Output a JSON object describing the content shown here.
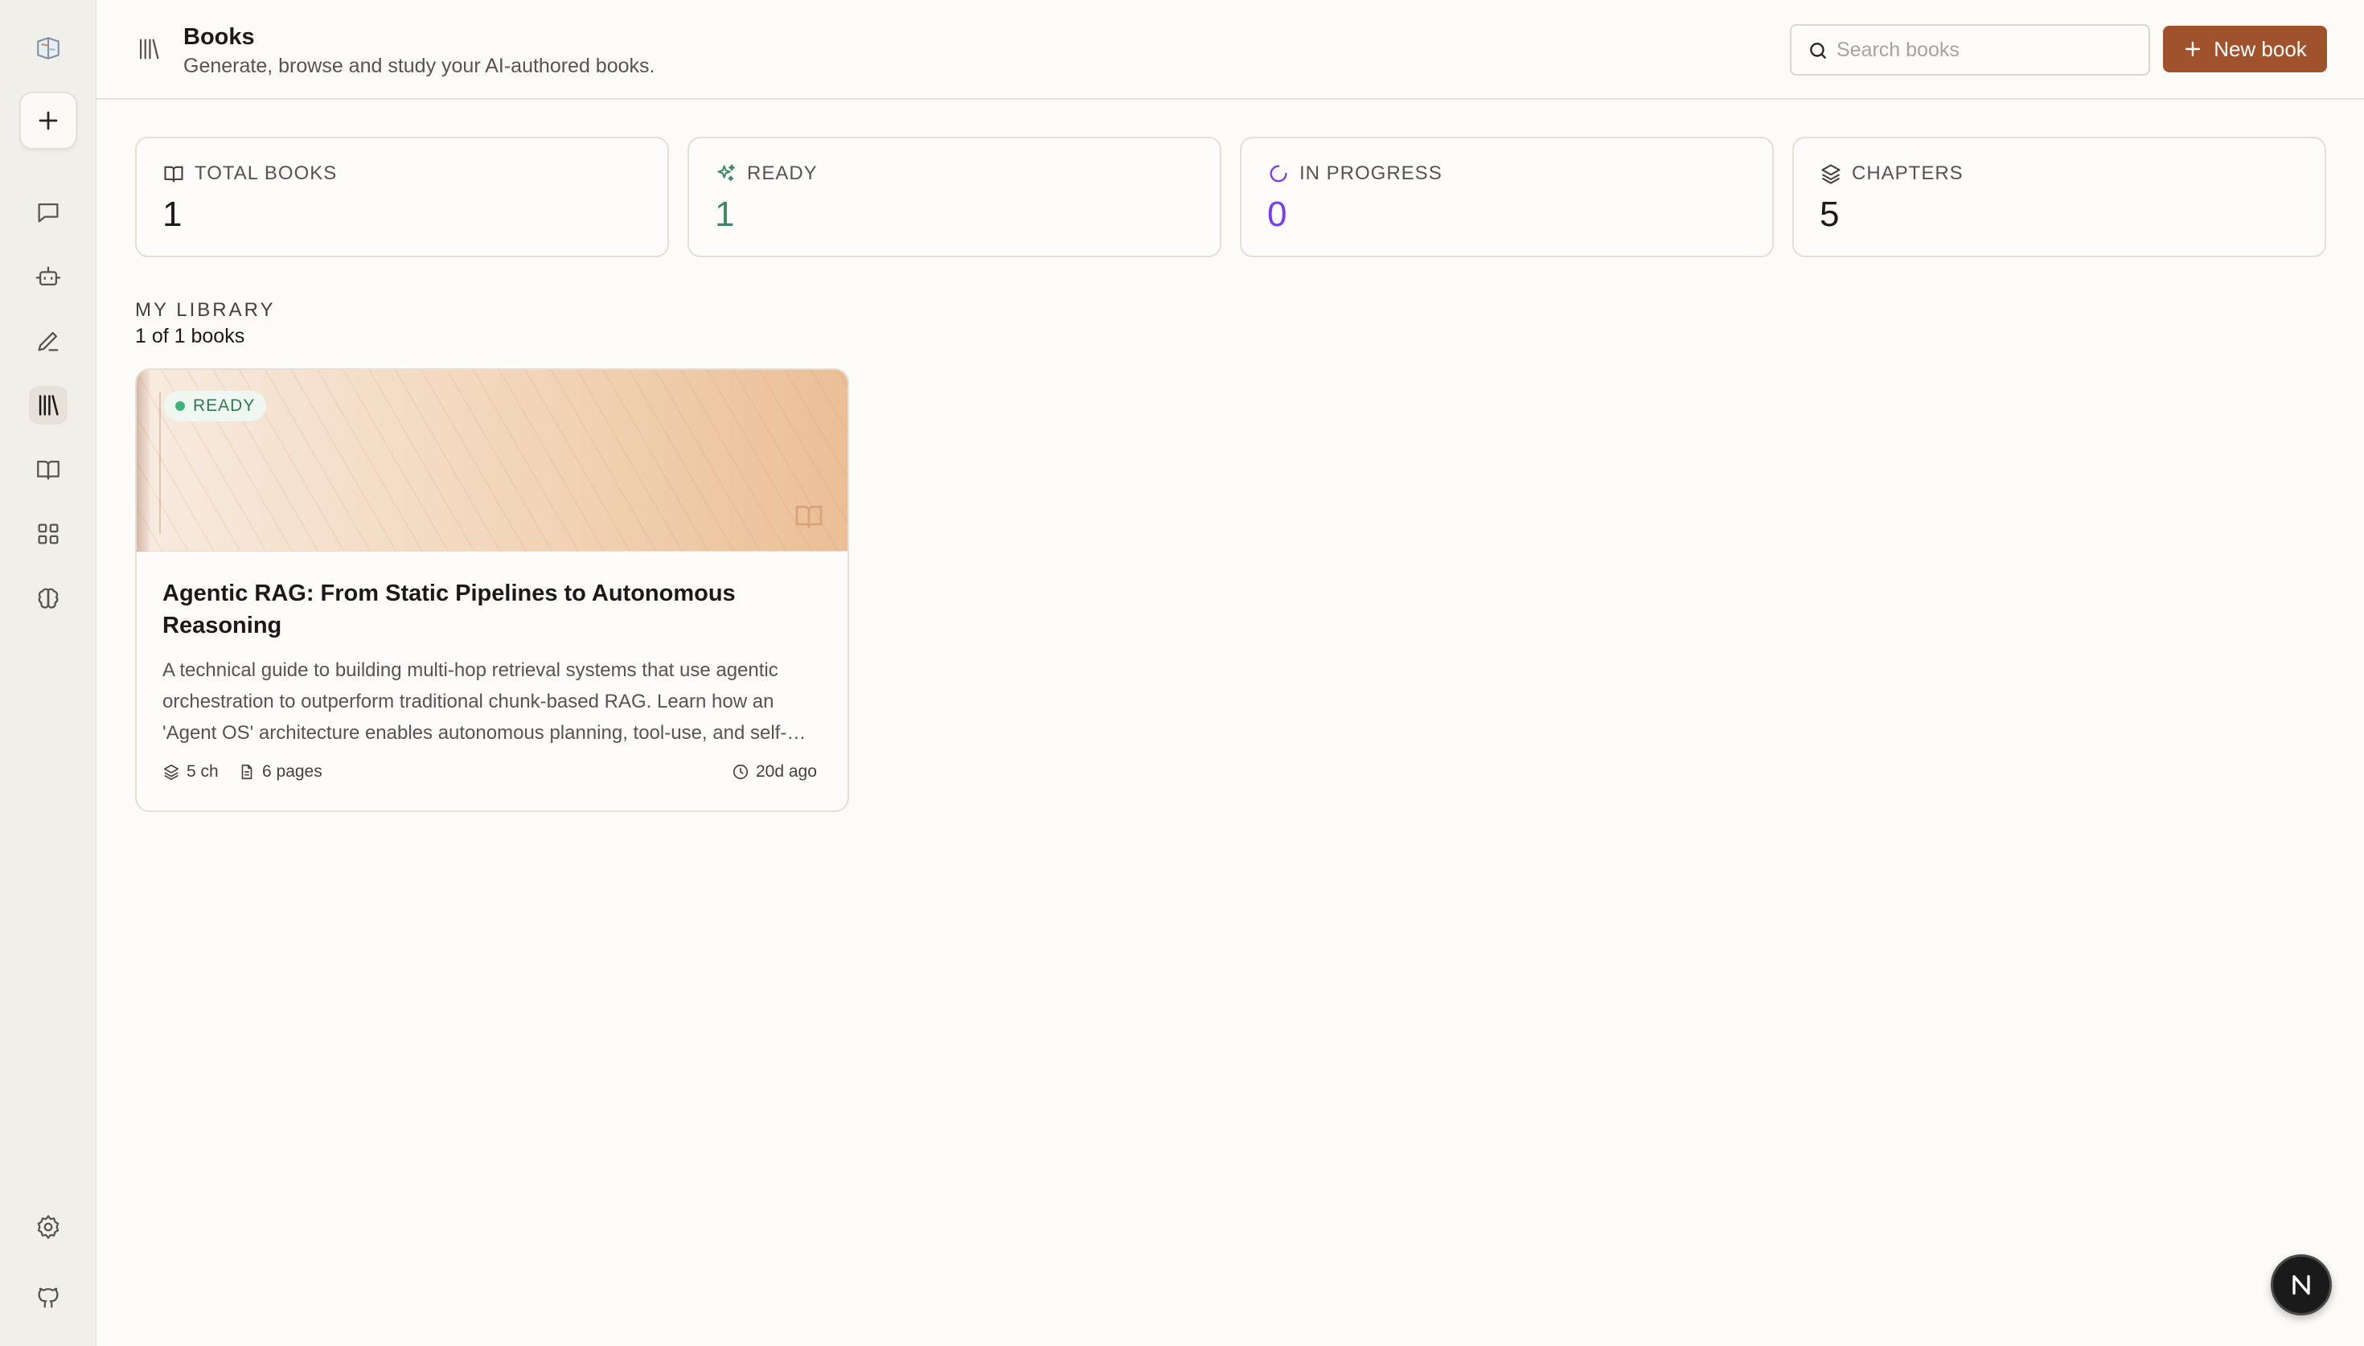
{
  "sidebar": {
    "items": [
      {
        "name": "chat",
        "icon": "message-square-icon"
      },
      {
        "name": "agents",
        "icon": "bot-icon"
      },
      {
        "name": "write",
        "icon": "pencil-icon"
      },
      {
        "name": "books",
        "icon": "library-icon",
        "active": true
      },
      {
        "name": "reader",
        "icon": "book-open-icon"
      },
      {
        "name": "apps",
        "icon": "grid-icon"
      },
      {
        "name": "brain",
        "icon": "brain-icon"
      }
    ],
    "bottom": [
      {
        "name": "settings",
        "icon": "gear-icon"
      },
      {
        "name": "github",
        "icon": "github-icon"
      }
    ]
  },
  "header": {
    "title": "Books",
    "subtitle": "Generate, browse and study your AI-authored books.",
    "search_placeholder": "Search books",
    "search_value": "",
    "new_book_label": "New book"
  },
  "stats": [
    {
      "label": "TOTAL BOOKS",
      "value": "1",
      "icon": "book-open-icon",
      "color": "#1c1917"
    },
    {
      "label": "READY",
      "value": "1",
      "icon": "sparkles-icon",
      "color": "#3f8a63"
    },
    {
      "label": "IN PROGRESS",
      "value": "0",
      "icon": "loader-icon",
      "color": "#7c3aed"
    },
    {
      "label": "CHAPTERS",
      "value": "5",
      "icon": "layers-icon",
      "color": "#1c1917"
    }
  ],
  "library": {
    "heading": "MY LIBRARY",
    "count_text": "1 of 1 books",
    "books": [
      {
        "status": "READY",
        "title": "Agentic RAG: From Static Pipelines to Autonomous Reasoning",
        "description": "A technical guide to building multi-hop retrieval systems that use agentic orchestration to outperform traditional chunk-based RAG. Learn how an 'Agent OS' architecture enables autonomous planning, tool-use, and self-correction.",
        "chapters": "5 ch",
        "pages": "6 pages",
        "updated": "20d ago"
      }
    ]
  },
  "colors": {
    "accent": "#a0522d",
    "ready_green": "#3f8a63",
    "progress_purple": "#7c3aed"
  }
}
